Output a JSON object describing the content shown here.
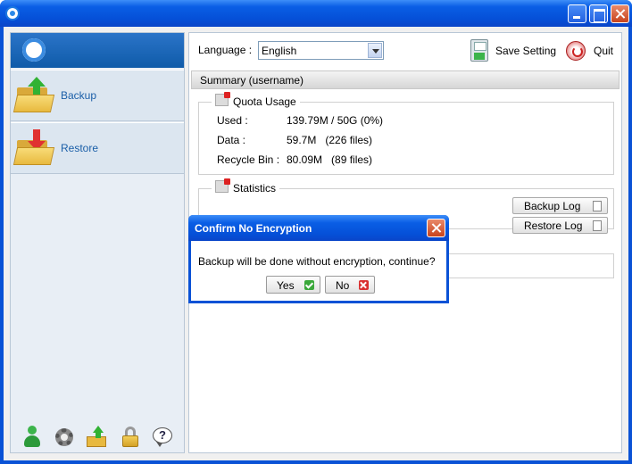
{
  "sidebar": {
    "items": [
      {
        "label": "Backup",
        "icon": "folder-upload-icon"
      },
      {
        "label": "Restore",
        "icon": "folder-download-icon"
      }
    ],
    "footer_icons": [
      "user-icon",
      "gear-icon",
      "upload-icon",
      "lock-icon",
      "help-icon"
    ]
  },
  "toolbar": {
    "language_label": "Language :",
    "language_value": "English",
    "save_label": "Save Setting",
    "quit_label": "Quit"
  },
  "summary": {
    "title": "Summary (username)",
    "quota": {
      "title": "Quota Usage",
      "rows": [
        {
          "key": "Used :",
          "value": "139.79M / 50G (0%)"
        },
        {
          "key": "Data :",
          "value": "59.7M   (226 files)"
        },
        {
          "key": "Recycle Bin :",
          "value": "80.09M   (89 files)"
        }
      ]
    },
    "statistics": {
      "title": "Statistics"
    },
    "backup_log_label": "Backup Log",
    "restore_log_label": "Restore Log"
  },
  "dialog": {
    "title": "Confirm No Encryption",
    "message": "Backup will be done without encryption, continue?",
    "yes_label": "Yes",
    "no_label": "No"
  },
  "colors": {
    "titlebar": "#0a5ee5",
    "sidebar_header": "#1f66b8",
    "link_text": "#1b5fa8"
  }
}
